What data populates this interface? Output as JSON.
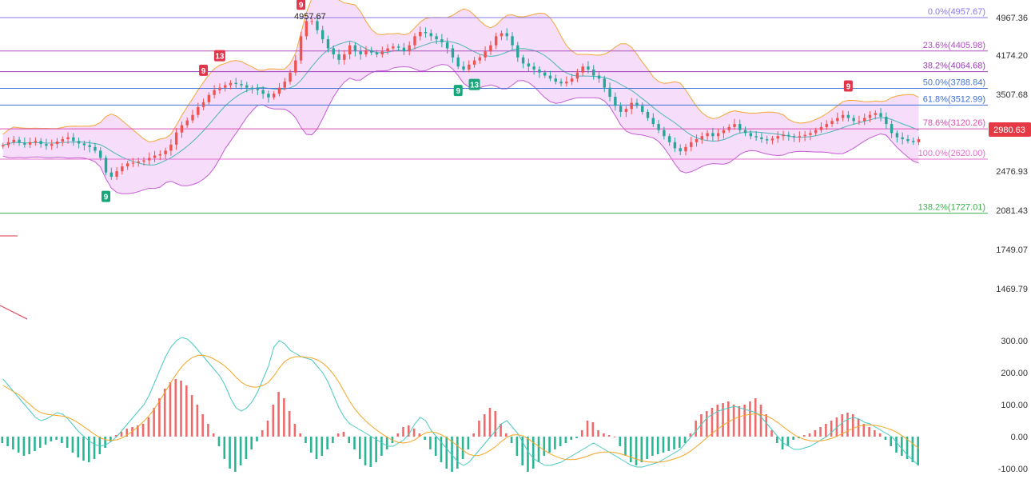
{
  "chart_data": {
    "type": "candlestick",
    "price_axis": {
      "ticks": [
        "4967.36",
        "4174.20",
        "3507.68",
        "2476.93",
        "2081.43",
        "1749.07",
        "1469.79"
      ],
      "current_price": "2980.63"
    },
    "fibonacci_levels": [
      {
        "label": "0.0%(4957.67)",
        "price": 4957.67,
        "color": "#8c7ae6"
      },
      {
        "label": "23.6%(4405.98)",
        "price": 4405.98,
        "color": "#b04fc4"
      },
      {
        "label": "38.2%(4064.68)",
        "price": 4064.68,
        "color": "#9b3fb8"
      },
      {
        "label": "50.0%(3788.84)",
        "price": 3788.84,
        "color": "#4a78d6"
      },
      {
        "label": "61.8%(3512.99)",
        "price": 3512.99,
        "color": "#3f6fd6"
      },
      {
        "label": "78.6%(3120.26)",
        "price": 3120.26,
        "color": "#d94fb3"
      },
      {
        "label": "100.0%(2620.00)",
        "price": 2620.0,
        "color": "#e36fcd"
      },
      {
        "label": "138.2%(1727.01)",
        "price": 1727.01,
        "color": "#3cb04c"
      }
    ],
    "peak_label": "4957.67",
    "markers": [
      {
        "text": "9",
        "idx": 19,
        "color": "#16a67a",
        "pos": "below"
      },
      {
        "text": "9",
        "idx": 37,
        "color": "#e0354b",
        "pos": "above"
      },
      {
        "text": "13",
        "idx": 40,
        "color": "#e0354b",
        "pos": "above"
      },
      {
        "text": "9",
        "idx": 55,
        "color": "#e0354b",
        "pos": "above"
      },
      {
        "text": "9",
        "idx": 84,
        "color": "#16a67a",
        "pos": "below"
      },
      {
        "text": "13",
        "idx": 87,
        "color": "#16a67a",
        "pos": "below"
      },
      {
        "text": "9",
        "idx": 156,
        "color": "#e0354b",
        "pos": "above"
      }
    ],
    "price_path": [
      2850,
      2900,
      2940,
      2890,
      2860,
      2900,
      2920,
      2870,
      2840,
      2870,
      2910,
      2950,
      2980,
      2920,
      2880,
      2850,
      2820,
      2760,
      2640,
      2400,
      2330,
      2420,
      2500,
      2550,
      2560,
      2580,
      2600,
      2640,
      2680,
      2700,
      2760,
      2860,
      3060,
      3180,
      3260,
      3350,
      3480,
      3560,
      3680,
      3760,
      3800,
      3840,
      3880,
      3860,
      3840,
      3800,
      3780,
      3760,
      3700,
      3640,
      3700,
      3800,
      3900,
      4050,
      4250,
      4650,
      4900,
      4900,
      4750,
      4600,
      4450,
      4350,
      4260,
      4350,
      4500,
      4400,
      4350,
      4420,
      4380,
      4350,
      4400,
      4450,
      4480,
      4460,
      4400,
      4500,
      4650,
      4720,
      4700,
      4650,
      4600,
      4550,
      4450,
      4300,
      4150,
      4100,
      4180,
      4250,
      4300,
      4400,
      4500,
      4650,
      4700,
      4650,
      4500,
      4300,
      4200,
      4150,
      4100,
      4050,
      4000,
      3950,
      3900,
      3870,
      3900,
      3950,
      4050,
      4150,
      4100,
      4000,
      3950,
      3800,
      3650,
      3500,
      3400,
      3450,
      3550,
      3500,
      3400,
      3300,
      3200,
      3100,
      3000,
      2900,
      2800,
      2750,
      2820,
      2900,
      2950,
      3000,
      3050,
      3000,
      3050,
      3100,
      3150,
      3200,
      3100,
      3050,
      3000,
      2980,
      2950,
      2930,
      2960,
      3000,
      3020,
      3000,
      2980,
      3000,
      3020,
      3050,
      3100,
      3150,
      3200,
      3250,
      3300,
      3350,
      3300,
      3250,
      3250,
      3300,
      3350,
      3380,
      3320,
      3200,
      3050,
      2980,
      2950,
      2920,
      2900,
      2950
    ],
    "macd_axis": {
      "ticks": [
        "300.00",
        "200.00",
        "100.00",
        "0.00",
        "-100.00"
      ]
    },
    "macd_hist": [
      -20,
      -30,
      -40,
      -50,
      -60,
      -55,
      -45,
      -35,
      -25,
      -15,
      -10,
      -20,
      -35,
      -50,
      -65,
      -75,
      -80,
      -70,
      -55,
      -35,
      -15,
      5,
      15,
      25,
      30,
      35,
      40,
      60,
      90,
      120,
      150,
      170,
      180,
      175,
      160,
      130,
      100,
      70,
      40,
      10,
      -30,
      -70,
      -100,
      -110,
      -90,
      -70,
      -40,
      -15,
      20,
      50,
      100,
      140,
      120,
      80,
      40,
      10,
      -20,
      -50,
      -70,
      -60,
      -40,
      -20,
      10,
      15,
      -20,
      -40,
      -70,
      -90,
      -95,
      -80,
      -60,
      -40,
      -20,
      10,
      30,
      35,
      25,
      10,
      -10,
      -40,
      -60,
      -80,
      -100,
      -110,
      -100,
      -70,
      -40,
      10,
      50,
      70,
      90,
      80,
      40,
      10,
      -20,
      -60,
      -90,
      -110,
      -100,
      -80,
      -60,
      -50,
      -40,
      -30,
      -20,
      -10,
      -5,
      20,
      50,
      45,
      20,
      10,
      5,
      0,
      -30,
      -60,
      -80,
      -90,
      -80,
      -70,
      -60,
      -55,
      -50,
      -45,
      -40,
      -35,
      -20,
      10,
      50,
      70,
      80,
      90,
      100,
      105,
      110,
      100,
      95,
      100,
      110,
      120,
      100,
      70,
      20,
      -20,
      -40,
      -30,
      -10,
      -5,
      5,
      10,
      20,
      30,
      40,
      50,
      60,
      70,
      75,
      70,
      55,
      40,
      30,
      20,
      10,
      -10,
      -30,
      -50,
      -60,
      -70,
      -80,
      -90
    ],
    "macd_line": [
      180,
      160,
      140,
      120,
      100,
      80,
      60,
      50,
      55,
      65,
      75,
      70,
      55,
      35,
      15,
      0,
      -15,
      -25,
      -30,
      -25,
      -15,
      0,
      20,
      40,
      60,
      80,
      100,
      130,
      170,
      210,
      250,
      280,
      300,
      310,
      305,
      290,
      270,
      250,
      230,
      210,
      190,
      160,
      120,
      90,
      80,
      90,
      110,
      140,
      180,
      220,
      280,
      300,
      290,
      270,
      260,
      250,
      245,
      240,
      220,
      200,
      170,
      130,
      90,
      60,
      40,
      30,
      20,
      10,
      0,
      -10,
      -20,
      -30,
      -30,
      -20,
      -10,
      10,
      40,
      60,
      50,
      20,
      0,
      -20,
      -40,
      -60,
      -80,
      -90,
      -80,
      -60,
      -40,
      -20,
      0,
      20,
      40,
      50,
      30,
      10,
      -20,
      -50,
      -70,
      -80,
      -90,
      -90,
      -85,
      -80,
      -70,
      -60,
      -50,
      -40,
      -30,
      -20,
      -30,
      -40,
      -50,
      -60,
      -70,
      -80,
      -90,
      -95,
      -95,
      -90,
      -85,
      -80,
      -70,
      -60,
      -50,
      -40,
      -20,
      0,
      20,
      40,
      60,
      70,
      80,
      85,
      90,
      95,
      90,
      85,
      80,
      75,
      60,
      40,
      20,
      0,
      -20,
      -30,
      -40,
      -40,
      -35,
      -30,
      -20,
      -10,
      0,
      15,
      30,
      45,
      55,
      60,
      55,
      45,
      40,
      30,
      20,
      10,
      0,
      -20,
      -40,
      -60,
      -75,
      -90
    ],
    "signal_line": [
      160,
      150,
      140,
      130,
      115,
      100,
      85,
      75,
      70,
      68,
      66,
      64,
      60,
      52,
      42,
      30,
      18,
      6,
      -4,
      -10,
      -12,
      -10,
      -4,
      6,
      18,
      32,
      48,
      66,
      88,
      114,
      142,
      170,
      196,
      218,
      236,
      248,
      254,
      254,
      250,
      242,
      232,
      220,
      204,
      186,
      170,
      160,
      155,
      155,
      160,
      170,
      190,
      215,
      235,
      245,
      250,
      250,
      248,
      246,
      240,
      230,
      215,
      195,
      170,
      140,
      110,
      85,
      65,
      48,
      33,
      20,
      8,
      -3,
      -12,
      -18,
      -20,
      -17,
      -10,
      2,
      12,
      15,
      12,
      5,
      -5,
      -17,
      -30,
      -44,
      -55,
      -60,
      -58,
      -52,
      -42,
      -30,
      -15,
      -2,
      5,
      6,
      2,
      -8,
      -20,
      -32,
      -44,
      -54,
      -62,
      -68,
      -72,
      -72,
      -70,
      -66,
      -60,
      -54,
      -50,
      -48,
      -48,
      -50,
      -54,
      -59,
      -65,
      -71,
      -76,
      -79,
      -80,
      -80,
      -78,
      -74,
      -69,
      -63,
      -55,
      -44,
      -31,
      -17,
      -2,
      12,
      25,
      37,
      47,
      56,
      63,
      67,
      70,
      71,
      69,
      64,
      55,
      44,
      31,
      18,
      6,
      -3,
      -9,
      -13,
      -14,
      -13,
      -10,
      -5,
      2,
      10,
      19,
      27,
      33,
      36,
      37,
      35,
      32,
      27,
      21,
      13,
      2,
      -10,
      -23,
      -37
    ],
    "colors": {
      "up": "#ef5350",
      "down": "#26a69a",
      "band_fill": "#f3d1f7",
      "band_upper": "#f5a637",
      "band_lower": "#c45ed6",
      "mid_line": "#49b6b6",
      "macd": "#49c9c2",
      "signal": "#f5a524",
      "hist_up": "#ef6b6b",
      "hist_down": "#2bb597",
      "current_price_bg": "#e53945"
    }
  }
}
